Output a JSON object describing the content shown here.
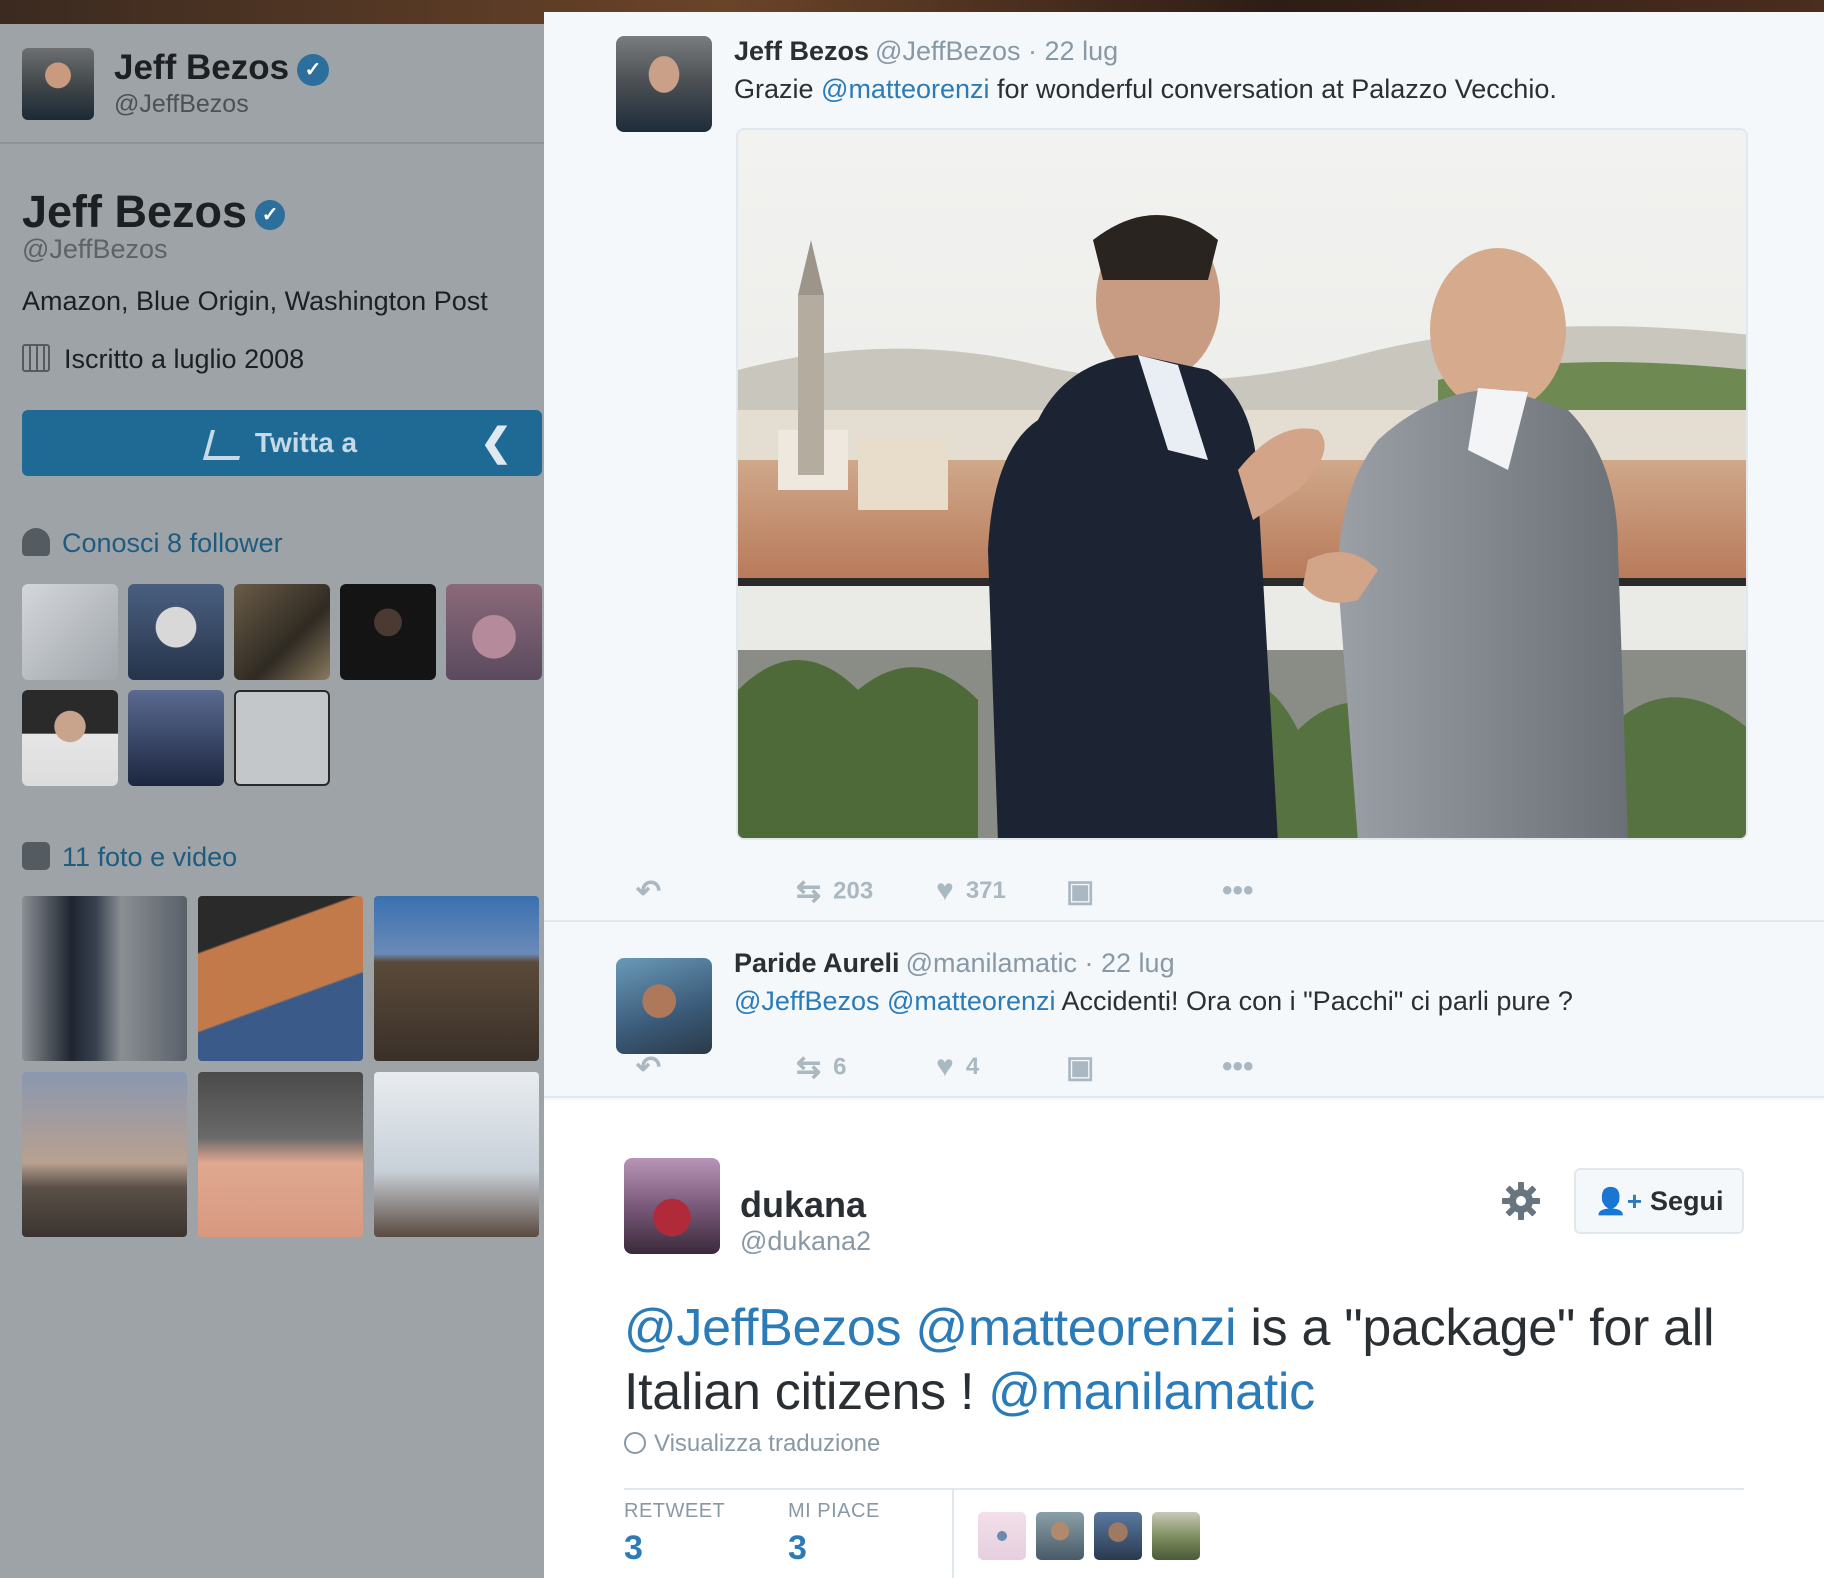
{
  "sidebar": {
    "header_name": "Jeff Bezos",
    "header_handle": "@JeffBezos",
    "big_name": "Jeff Bezos",
    "big_handle": "@JeffBezos",
    "bio": "Amazon, Blue Origin, Washington Post",
    "joined": "Iscritto a luglio 2008",
    "tweet_to_label": "Twitta a",
    "followers_label": "Conosci 8 follower",
    "media_label": "11 foto e video"
  },
  "tweets": [
    {
      "name": "Jeff Bezos",
      "handle": "@JeffBezos",
      "date": "· 22 lug",
      "text_prefix": "Grazie ",
      "mention": "@matteorenzi",
      "text_suffix": " for wonderful conversation at Palazzo Vecchio.",
      "retweets": "203",
      "likes": "371"
    },
    {
      "name": "Paride Aureli",
      "handle": "@manilamatic",
      "date": "· 22 lug",
      "mention1": "@JeffBezos",
      "mention2": "@matteorenzi",
      "text": " Accidenti! Ora con i \"Pacchi\" ci parli pure ?",
      "retweets": "6",
      "likes": "4"
    }
  ],
  "focused": {
    "name": "dukana",
    "handle": "@dukana2",
    "follow_label": "Segui",
    "mention1": "@JeffBezos",
    "mention2": "@matteorenzi",
    "text_mid": " is a \"package\" for all Italian citizens ! ",
    "mention3": "@manilamatic",
    "translate_label": "Visualizza traduzione",
    "retweet_label": "RETWEET",
    "retweet_count": "3",
    "likes_label": "MI PIACE",
    "likes_count": "3"
  },
  "icons": {
    "reply": "reply-icon",
    "retweet": "retweet-icon",
    "like": "heart-icon",
    "analytics": "analytics-icon",
    "more": "more-icon",
    "gear": "gear-icon",
    "follow": "add-user-icon",
    "globe": "globe-icon"
  },
  "colors": {
    "link": "#2b7bb9",
    "action_grey": "#aab8c2",
    "sidebar_overlay": "#9ea3a7",
    "tweet_to_button": "#1f6a94"
  }
}
